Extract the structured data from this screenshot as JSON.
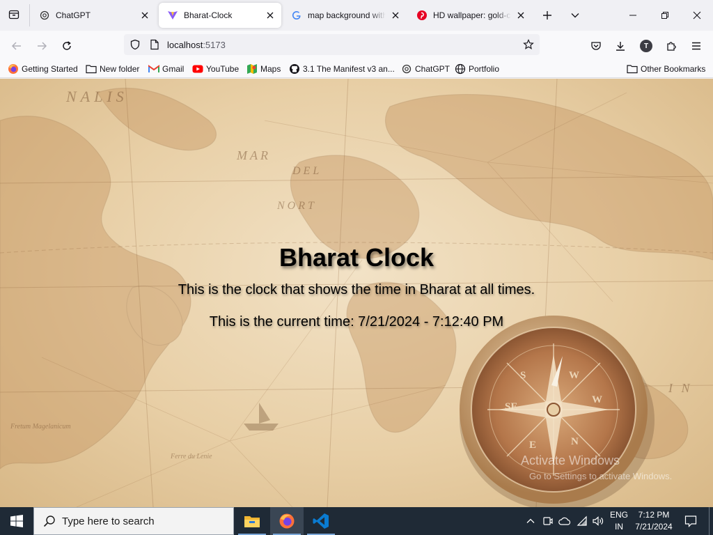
{
  "browser": {
    "tabs": [
      {
        "title": "ChatGPT",
        "active": false,
        "favicon": "chatgpt-icon"
      },
      {
        "title": "Bharat-Clock",
        "active": true,
        "favicon": "vite-icon"
      },
      {
        "title": "map background with compass",
        "active": false,
        "favicon": "google-icon"
      },
      {
        "title": "HD wallpaper: gold-colored compass",
        "active": false,
        "favicon": "pinterest-icon"
      }
    ],
    "url": {
      "host": "localhost",
      "port": ":5173"
    },
    "profile_initial": "T",
    "bookmarks": [
      {
        "label": "Getting Started",
        "icon": "firefox-icon"
      },
      {
        "label": "New folder",
        "icon": "folder-icon"
      },
      {
        "label": "Gmail",
        "icon": "gmail-icon"
      },
      {
        "label": "YouTube",
        "icon": "youtube-icon"
      },
      {
        "label": "Maps",
        "icon": "maps-icon"
      },
      {
        "label": "3.1 The Manifest v3 an...",
        "icon": "github-icon"
      },
      {
        "label": "ChatGPT",
        "icon": "chatgpt-icon"
      },
      {
        "label": "Portfolio",
        "icon": "globe-icon"
      }
    ],
    "other_bookmarks": "Other Bookmarks"
  },
  "page": {
    "title": "Bharat Clock",
    "description": "This is the clock that shows the time in Bharat at all times.",
    "current_time": "This is the current time: 7/21/2024 - 7:12:40 PM"
  },
  "watermark": {
    "line1": "Activate Windows",
    "line2": "Go to Settings to activate Windows."
  },
  "taskbar": {
    "search_placeholder": "Type here to search",
    "language": "ENG",
    "region": "IN",
    "time": "7:12 PM",
    "date": "7/21/2024"
  },
  "colors": {
    "taskbar": "#1f2a36",
    "accent": "#0061e0",
    "youtube": "#ff0000",
    "pinterest": "#e60023"
  }
}
